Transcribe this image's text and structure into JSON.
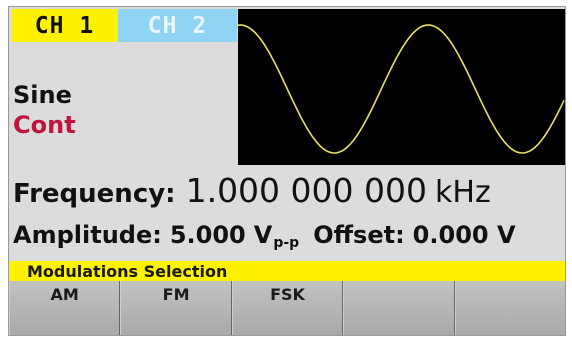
{
  "channels": {
    "ch1_label": "CH 1",
    "ch2_label": "CH 2",
    "active": "CH 1"
  },
  "waveform": {
    "type": "Sine",
    "mode": "Cont",
    "trace_color": "#e8e060"
  },
  "frequency": {
    "label": "Frequency:",
    "value": "1.000 000 000",
    "unit": "kHz"
  },
  "amplitude": {
    "label": "Amplitude:",
    "value": "5.000",
    "unit": "V",
    "unit_sub": "p-p"
  },
  "offset": {
    "label": "Offset:",
    "value": "0.000 V"
  },
  "menu": {
    "title": "Modulations Selection",
    "softkeys": [
      "AM",
      "FM",
      "FSK",
      "",
      ""
    ]
  },
  "colors": {
    "ch1_tab": "#fff200",
    "ch2_tab": "#8fd3f5",
    "menu_bar": "#fff200",
    "mode_text": "#c0143c"
  }
}
